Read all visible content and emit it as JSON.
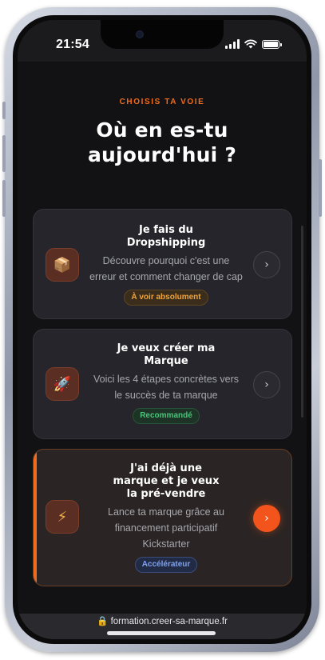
{
  "status_bar": {
    "time": "21:54"
  },
  "page": {
    "eyebrow": "CHOISIS TA VOIE",
    "heading_line1": "Où en es-tu",
    "heading_line2": "aujourd'hui ?"
  },
  "cards": [
    {
      "icon": "package-icon",
      "icon_glyph": "📦",
      "title_line1": "Je fais du",
      "title_line2": "Dropshipping",
      "desc_line1": "Découvre pourquoi c'est une",
      "desc_line2": "erreur et comment changer de cap",
      "badge": "À voir absolument",
      "badge_color": "#f0a43c"
    },
    {
      "icon": "rocket-icon",
      "icon_glyph": "🚀",
      "title_line1": "Je veux créer ma",
      "title_line2": "Marque",
      "desc_line1": "Voici les 4 étapes concrètes vers",
      "desc_line2": "le succès de ta marque",
      "badge": "Recommandé",
      "badge_color": "#49c47a"
    },
    {
      "icon": "lightning-icon",
      "icon_glyph": "⚡",
      "title_line1": "J'ai déjà une",
      "title_line2": "marque et je veux",
      "title_line3": "la pré-vendre",
      "desc_line1": "Lance ta marque grâce au",
      "desc_line2": "financement participatif",
      "desc_line3": "Kickstarter",
      "badge": "Accélérateur",
      "badge_color": "#7ea2ee"
    }
  ],
  "colors": {
    "accent": "#f26a1b",
    "background": "#121214",
    "card": "#25252b"
  },
  "browser": {
    "url": "formation.creer-sa-marque.fr",
    "lock_icon": "lock-icon"
  }
}
